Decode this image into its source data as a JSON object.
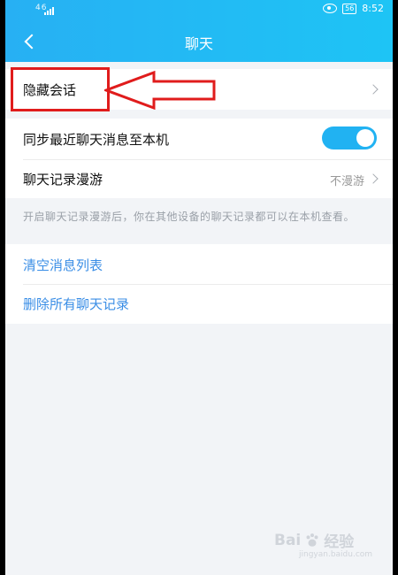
{
  "statusbar": {
    "left": "46",
    "network": "56",
    "time": "8:52"
  },
  "header": {
    "title": "聊天"
  },
  "rows": {
    "hidden_chats": "隐藏会话",
    "sync": "同步最近聊天消息至本机",
    "roaming": "聊天记录漫游",
    "roaming_value": "不漫游",
    "roaming_desc": "开启聊天记录漫游后，你在其他设备的聊天记录都可以在本机查看。",
    "clear_list": "清空消息列表",
    "delete_all": "删除所有聊天记录"
  },
  "sync_toggle": {
    "state": "on",
    "color": "#21b2f2"
  },
  "annotation": {
    "color": "#e01c1c"
  },
  "watermark": {
    "brand": "Bai",
    "brand2": "经验",
    "sub": "jingyan.baidu.com"
  }
}
